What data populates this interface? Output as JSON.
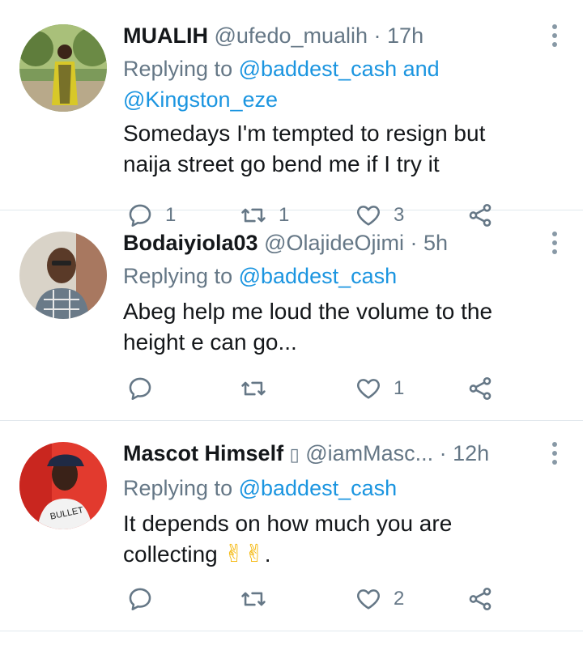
{
  "tweets": [
    {
      "name": "MUALIH",
      "handle": "@ufedo_mualih",
      "time": "· 17h",
      "replying_prefix": "Replying to ",
      "mentions_line1": "@baddest_cash and",
      "mentions_line2": "@Kingston_eze",
      "text_line1": "Somedays I'm tempted to resign but",
      "text_line2": "naija street go bend me if I try it",
      "reply_count": "1",
      "retweet_count": "1",
      "like_count": "3"
    },
    {
      "name": "Bodaiyiola03",
      "handle": "@OlajideOjimi",
      "time": "· 5h",
      "replying_prefix": "Replying to ",
      "mentions_line1": "@baddest_cash",
      "text_line1": "Abeg help me loud the volume to the",
      "text_line2": "height e can go...",
      "reply_count": "",
      "retweet_count": "",
      "like_count": "1"
    },
    {
      "name": "Mascot Himself",
      "name_glyph": "▯",
      "handle": "@iamMasc...",
      "time": "· 12h",
      "replying_prefix": "Replying to ",
      "mentions_line1": "@baddest_cash",
      "text_line1": "It depends on how much you are",
      "text_line2": "collecting",
      "text_emoji": "✌✌",
      "text_end": ".",
      "reply_count": "",
      "retweet_count": "",
      "like_count": "2"
    }
  ],
  "icons": {
    "reply": "reply-icon",
    "retweet": "retweet-icon",
    "like": "heart-icon",
    "share": "share-icon",
    "more": "more-vertical-icon"
  },
  "colors": {
    "mention": "#1b95e0",
    "meta": "#657786",
    "text": "#14171a",
    "divider": "#e1e8ed"
  }
}
